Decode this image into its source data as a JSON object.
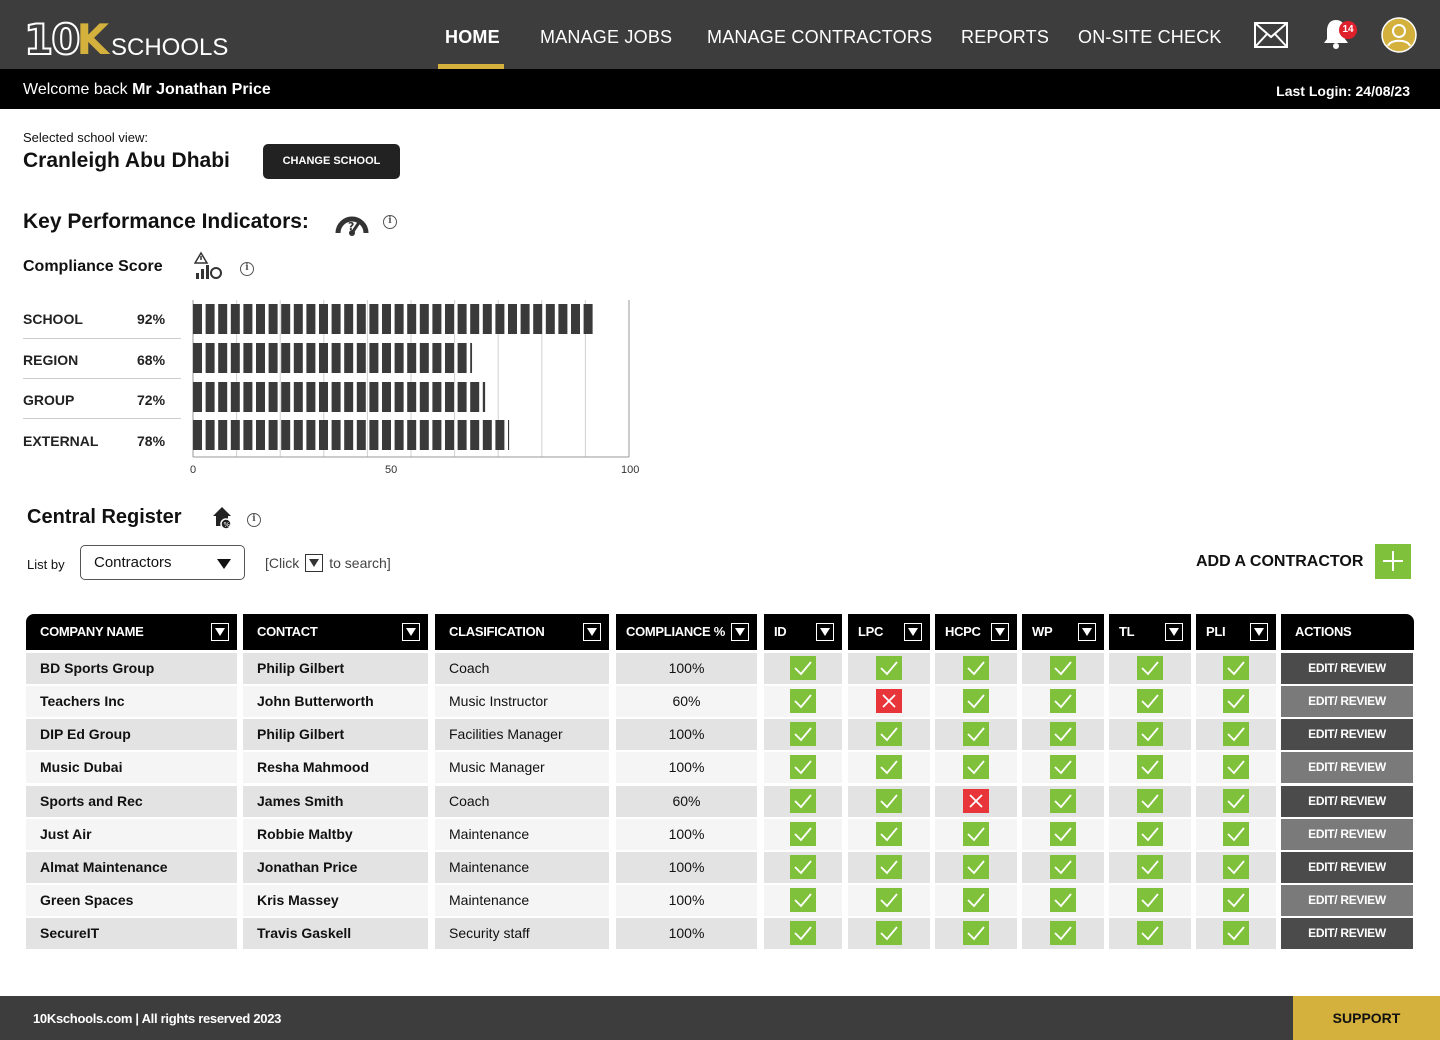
{
  "nav": {
    "logo_number": "10",
    "logo_k": "K",
    "logo_word": "SCHOOLS",
    "links": [
      "HOME",
      "MANAGE JOBS",
      "MANAGE CONTRACTORS",
      "REPORTS",
      "ON-SITE CHECK"
    ],
    "notification_count": "14",
    "icons": [
      "mail-icon",
      "bell-icon",
      "user-avatar-icon"
    ],
    "accent_color": "#d4b03c"
  },
  "welcome": {
    "prefix": "Welcome back ",
    "name": "Mr Jonathan Price",
    "last_login": "Last Login: 24/08/23"
  },
  "school": {
    "label": "Selected school view:",
    "name": "Cranleigh Abu Dhabi",
    "change_button": "CHANGE SCHOOL"
  },
  "kpi": {
    "title": "Key Performance Indicators:",
    "compliance_title": "Compliance Score"
  },
  "chart_data": {
    "type": "bar",
    "orientation": "horizontal",
    "categories": [
      "SCHOOL",
      "REGION",
      "GROUP",
      "EXTERNAL"
    ],
    "value_labels": [
      "92%",
      "68%",
      "72%",
      "78%"
    ],
    "values": [
      92,
      64,
      67,
      72.5
    ],
    "xlim": [
      0,
      100
    ],
    "x_ticks": [
      "0",
      "50",
      "100"
    ],
    "grid": true,
    "bar_color": "#3a3a3a"
  },
  "register": {
    "title": "Central Register",
    "list_by_label": "List by",
    "list_by_value": "Contractors",
    "hint_pre": "[Click",
    "hint_post": "to search]",
    "add_label": "ADD A CONTRACTOR",
    "headers": [
      "COMPANY NAME",
      "CONTACT",
      "CLASIFICATION",
      "COMPLIANCE %",
      "ID",
      "LPC",
      "HCPC",
      "WP",
      "TL",
      "PLI",
      "ACTIONS"
    ],
    "action_label": "EDIT/ REVIEW",
    "rows": [
      {
        "company": "BD Sports Group",
        "contact": "Philip Gilbert",
        "classification": "Coach",
        "compliance": "100%",
        "checks": [
          true,
          true,
          true,
          true,
          true,
          true
        ]
      },
      {
        "company": "Teachers Inc",
        "contact": "John Butterworth",
        "classification": "Music Instructor",
        "compliance": "60%",
        "checks": [
          true,
          false,
          true,
          true,
          true,
          true
        ]
      },
      {
        "company": "DIP Ed Group",
        "contact": "Philip Gilbert",
        "classification": "Facilities Manager",
        "compliance": "100%",
        "checks": [
          true,
          true,
          true,
          true,
          true,
          true
        ]
      },
      {
        "company": "Music Dubai",
        "contact": "Resha Mahmood",
        "classification": "Music Manager",
        "compliance": "100%",
        "checks": [
          true,
          true,
          true,
          true,
          true,
          true
        ]
      },
      {
        "company": "Sports and Rec",
        "contact": "James Smith",
        "classification": "Coach",
        "compliance": "60%",
        "checks": [
          true,
          true,
          false,
          true,
          true,
          true
        ]
      },
      {
        "company": "Just Air",
        "contact": "Robbie Maltby",
        "classification": "Maintenance",
        "compliance": "100%",
        "checks": [
          true,
          true,
          true,
          true,
          true,
          true
        ]
      },
      {
        "company": "Almat Maintenance",
        "contact": "Jonathan Price",
        "classification": "Maintenance",
        "compliance": "100%",
        "checks": [
          true,
          true,
          true,
          true,
          true,
          true
        ]
      },
      {
        "company": "Green Spaces",
        "contact": "Kris Massey",
        "classification": "Maintenance",
        "compliance": "100%",
        "checks": [
          true,
          true,
          true,
          true,
          true,
          true
        ]
      },
      {
        "company": "SecureIT",
        "contact": "Travis Gaskell",
        "classification": "Security staff",
        "compliance": "100%",
        "checks": [
          true,
          true,
          true,
          true,
          true,
          true
        ]
      }
    ]
  },
  "footer": {
    "text": "10Kschools.com | All rights reserved 2023",
    "support": "SUPPORT"
  }
}
